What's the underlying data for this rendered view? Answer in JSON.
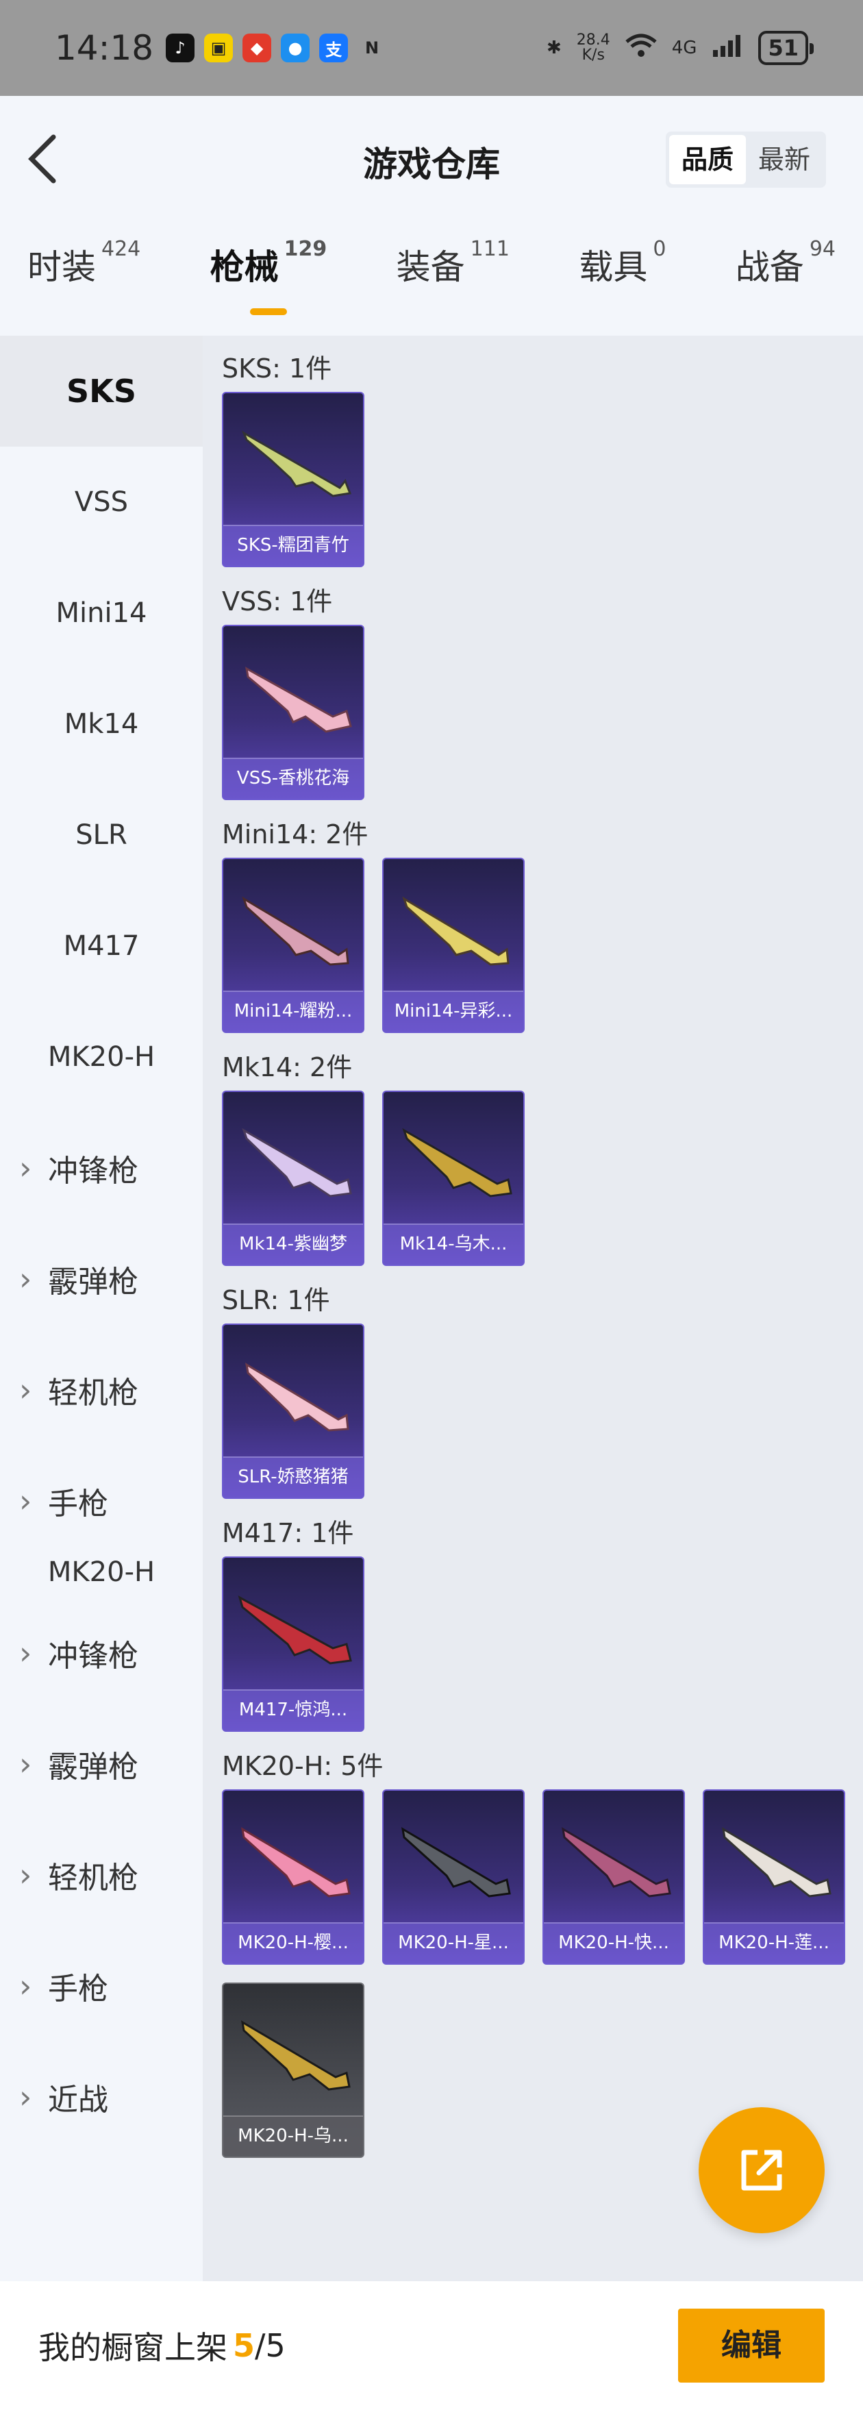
{
  "status": {
    "time": "14:18",
    "net_speed_top": "28.4",
    "net_speed_bottom": "K/s",
    "network": "4G",
    "battery": "51"
  },
  "header": {
    "title": "游戏仓库",
    "sort": [
      "品质",
      "最新"
    ]
  },
  "tabs": [
    {
      "label": "时装",
      "count": "424"
    },
    {
      "label": "枪械",
      "count": "129"
    },
    {
      "label": "装备",
      "count": "111"
    },
    {
      "label": "载具",
      "count": "0"
    },
    {
      "label": "战备",
      "count": "94"
    }
  ],
  "sidebar": [
    "SKS",
    "VSS",
    "Mini14",
    "Mk14",
    "SLR",
    "M417",
    "MK20-H",
    "冲锋枪",
    "霰弹枪",
    "轻机枪",
    "手枪",
    "MK20-H",
    "冲锋枪",
    "霰弹枪",
    "轻机枪",
    "手枪",
    "近战"
  ],
  "sections": [
    {
      "title": "SKS: 1件",
      "cards": [
        "SKS-糯团青竹"
      ]
    },
    {
      "title": "VSS: 1件",
      "cards": [
        "VSS-香桃花海"
      ]
    },
    {
      "title": "Mini14: 2件",
      "cards": [
        "Mini14-耀粉...",
        "Mini14-异彩..."
      ]
    },
    {
      "title": "Mk14: 2件",
      "cards": [
        "Mk14-紫幽梦",
        "Mk14-乌木..."
      ]
    },
    {
      "title": "SLR: 1件",
      "cards": [
        "SLR-娇憨猪猪"
      ]
    },
    {
      "title": "M417: 1件",
      "cards": [
        "M417-惊鸿..."
      ]
    },
    {
      "title": "MK20-H: 5件",
      "cards": [
        "MK20-H-樱...",
        "MK20-H-星...",
        "MK20-H-快...",
        "MK20-H-莲...",
        "MK20-H-乌..."
      ]
    }
  ],
  "bottom": {
    "label": "我的橱窗上架",
    "current": "5",
    "total": "/5",
    "edit": "编辑"
  },
  "colors": {
    "accent": "#f5a300",
    "card_purple": "#3b2f78"
  }
}
